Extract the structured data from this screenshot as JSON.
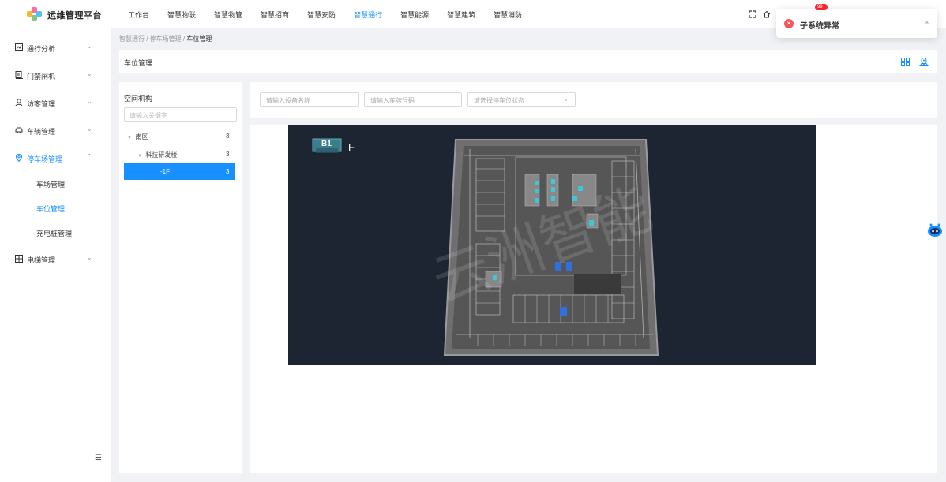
{
  "app": {
    "title": "运维管理平台"
  },
  "nav": [
    "工作台",
    "智慧物联",
    "智慧物管",
    "智慧招商",
    "智慧安防",
    "智慧通行",
    "智慧能源",
    "智慧建筑",
    "智慧消防"
  ],
  "nav_active_index": 5,
  "toast": {
    "message": "子系统异常",
    "badge": "99+"
  },
  "sidebar": {
    "items": [
      {
        "label": "通行分析",
        "icon": "chart-icon"
      },
      {
        "label": "门禁闸机",
        "icon": "gate-icon"
      },
      {
        "label": "访客管理",
        "icon": "visitor-icon"
      },
      {
        "label": "车辆管理",
        "icon": "car-icon"
      },
      {
        "label": "停车场管理",
        "icon": "location-icon"
      },
      {
        "label": "电梯管理",
        "icon": "grid-icon"
      }
    ],
    "subitems": [
      "车场管理",
      "车位管理",
      "充电桩管理"
    ]
  },
  "breadcrumb": {
    "l1": "智慧通行",
    "l2": "停车场管理",
    "l3": "车位管理"
  },
  "page": {
    "title": "车位管理"
  },
  "tree": {
    "title": "空间机构",
    "search_placeholder": "请输入关键字",
    "nodes": [
      {
        "label": "南区",
        "count": "3"
      },
      {
        "label": "科技研发楼",
        "count": "3"
      },
      {
        "label": "-1F",
        "count": "3"
      }
    ]
  },
  "filters": {
    "device_placeholder": "请输入设备名称",
    "plate_placeholder": "请输入车牌号码",
    "status_placeholder": "请选择停车位状态"
  },
  "map": {
    "floor": "B1",
    "floor_suffix": "F",
    "watermark": "云洲智能"
  },
  "colors": {
    "accent": "#1890ff",
    "error": "#f5565b"
  }
}
